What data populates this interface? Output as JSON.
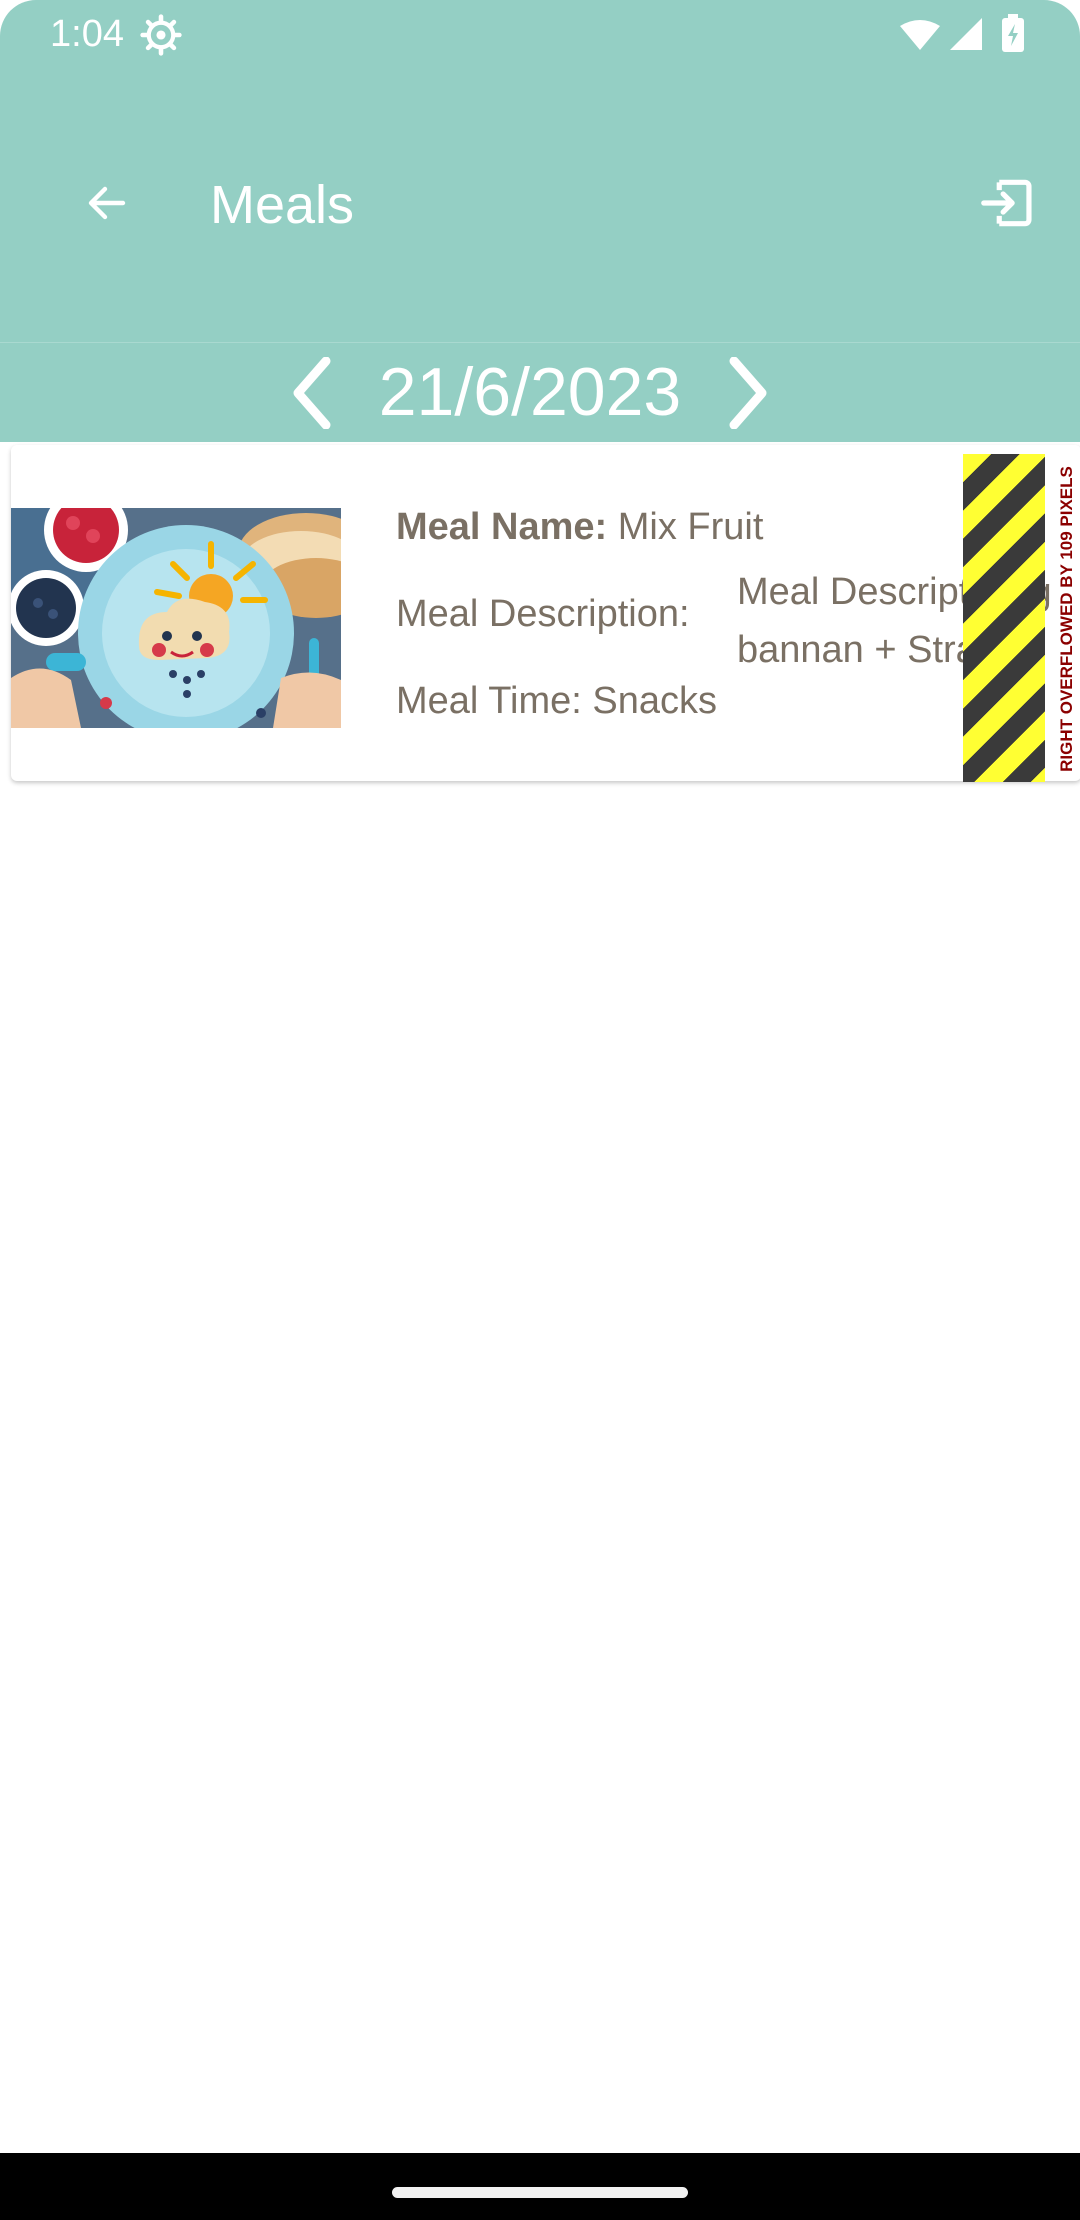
{
  "status_bar": {
    "time": "1:04",
    "icons": [
      "settings-icon",
      "wifi-icon",
      "signal-icon",
      "battery-icon"
    ]
  },
  "app_bar": {
    "title": "Meals",
    "back_icon": "arrow-back-icon",
    "logout_icon": "logout-icon",
    "background_color": "#94cfc4"
  },
  "date_nav": {
    "date": "21/6/2023",
    "prev_icon": "chevron-left-icon",
    "next_icon": "chevron-right-icon"
  },
  "meals": [
    {
      "name_label": "Meal Name:",
      "name": "Mix Fruit",
      "description_label": "Meal Description:",
      "description_line1": "Meal Description g",
      "description_line2": "bannan + Strawbe",
      "time_label": "Meal Time:",
      "time": "Snacks"
    }
  ],
  "overflow_warning": "RIGHT OVERFLOWED BY 109 PIXELS",
  "colors": {
    "accent": "#94cfc4",
    "text": "#7a7064",
    "overflow_yellow": "#ffff33",
    "overflow_dark": "#3a3a3a",
    "overflow_text": "#8b0000"
  }
}
